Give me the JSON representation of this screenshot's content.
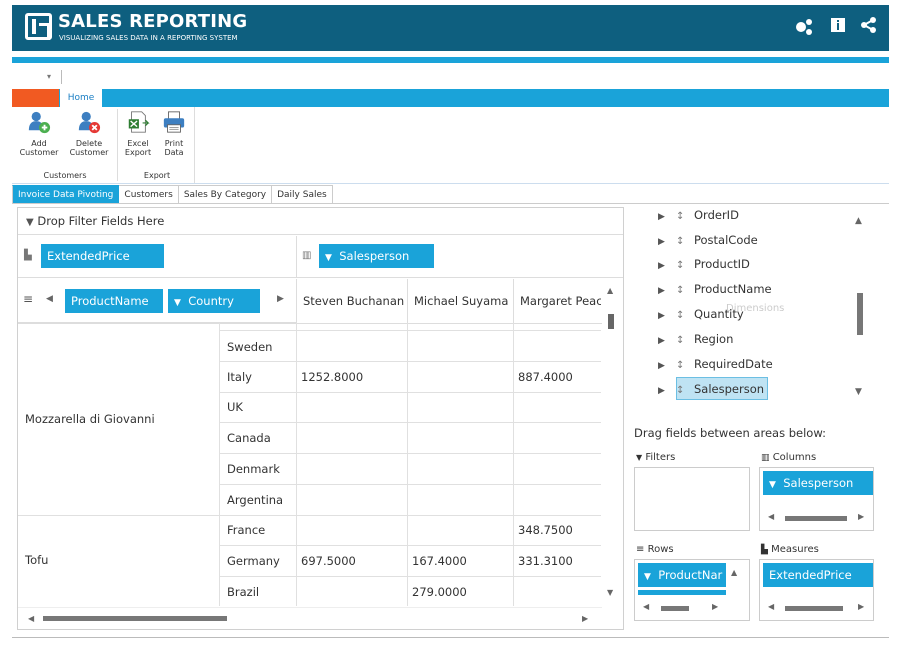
{
  "app": {
    "title": "SALES REPORTING",
    "subtitle": "VISUALIZING SALES DATA IN A REPORTING SYSTEM",
    "header_icons": [
      "settings-share-icon",
      "info-icon",
      "share-icon"
    ]
  },
  "qat": {
    "dropdown": "▾"
  },
  "ribbon": {
    "home_tab": "Home",
    "buttons": [
      {
        "label1": "Add",
        "label2": "Customer"
      },
      {
        "label1": "Delete",
        "label2": "Customer"
      },
      {
        "label1": "Excel",
        "label2": "Export"
      },
      {
        "label1": "Print",
        "label2": "Data"
      }
    ],
    "groups": [
      "Customers",
      "Export"
    ]
  },
  "tabs": [
    "Invoice Data Pivoting",
    "Customers",
    "Sales By Category",
    "Daily Sales"
  ],
  "pivot": {
    "filter_hint": "Drop Filter Fields Here",
    "data_field": "ExtendedPrice",
    "column_field": "Salesperson",
    "row_fields": [
      "ProductName",
      "Country"
    ],
    "columns": [
      "Steven Buchanan",
      "Michael Suyama",
      "Margaret Peac"
    ],
    "groups": [
      {
        "product": "Mozzarella di Giovanni",
        "rows": [
          {
            "country": "Sweden",
            "values": [
              "",
              "",
              ""
            ]
          },
          {
            "country": "Italy",
            "values": [
              "1252.8000",
              "",
              "887.4000"
            ]
          },
          {
            "country": "UK",
            "values": [
              "",
              "",
              ""
            ]
          },
          {
            "country": "Canada",
            "values": [
              "",
              "",
              ""
            ]
          },
          {
            "country": "Denmark",
            "values": [
              "",
              "",
              ""
            ]
          },
          {
            "country": "Argentina",
            "values": [
              "",
              "",
              ""
            ]
          }
        ]
      },
      {
        "product": "Tofu",
        "rows": [
          {
            "country": "France",
            "values": [
              "",
              "",
              "348.7500"
            ]
          },
          {
            "country": "Germany",
            "values": [
              "697.5000",
              "167.4000",
              "331.3100"
            ]
          },
          {
            "country": "Brazil",
            "values": [
              "",
              "279.0000",
              ""
            ]
          }
        ]
      }
    ]
  },
  "field_list": {
    "fields": [
      "OrderID",
      "PostalCode",
      "ProductID",
      "ProductName",
      "Quantity",
      "Region",
      "RequiredDate",
      "Salesperson"
    ],
    "selected": "Salesperson",
    "ghost_text": "Dimensions",
    "drag_hint": "Drag fields between areas below:",
    "areas": {
      "filters": {
        "label": "Filters"
      },
      "columns": {
        "label": "Columns",
        "item": "Salesperson"
      },
      "rows": {
        "label": "Rows",
        "item": "ProductNar"
      },
      "measures": {
        "label": "Measures",
        "item": "ExtendedPrice"
      }
    }
  },
  "colors": {
    "header": "#0e5f7f",
    "accent": "#1aa3d9",
    "file_tab": "#f15a22"
  }
}
